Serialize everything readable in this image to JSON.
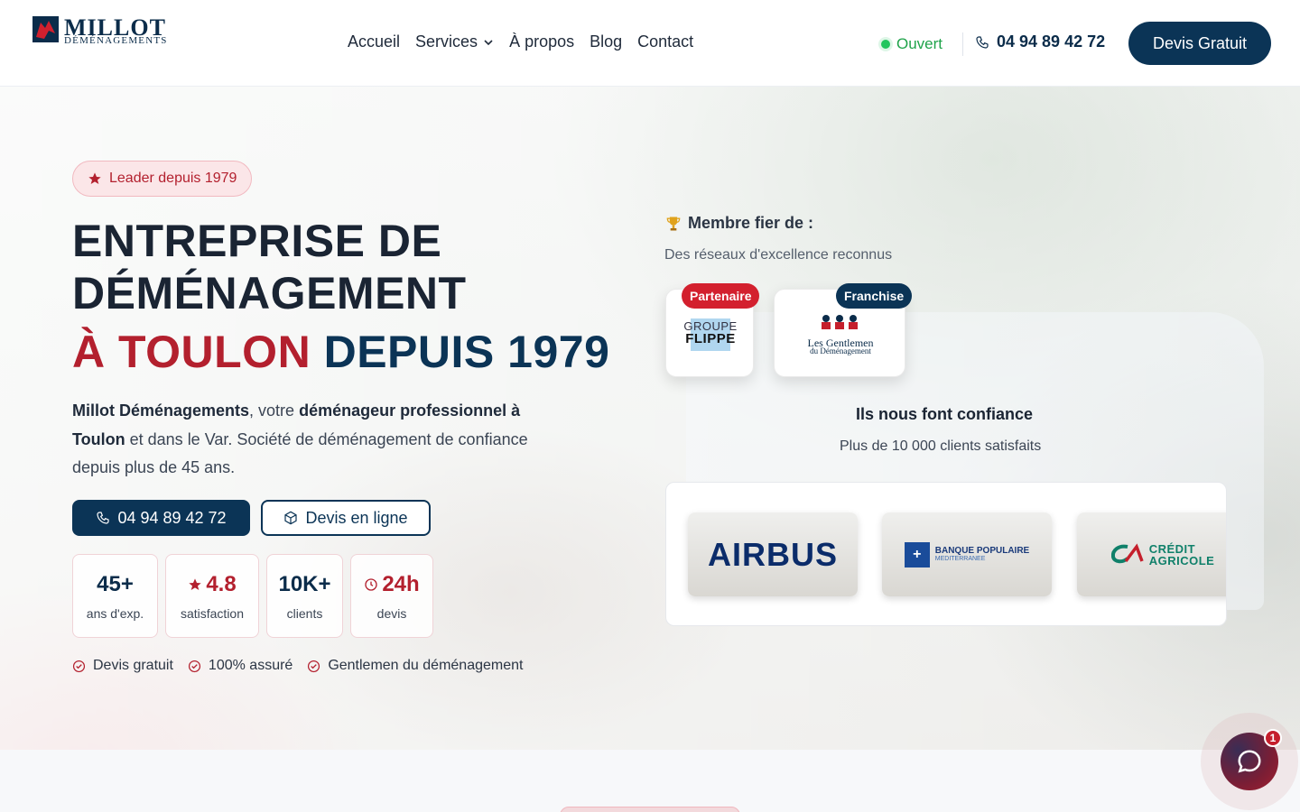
{
  "header": {
    "logo": {
      "title": "MILLOT",
      "subtitle": "DÉMÉNAGEMENTS"
    },
    "nav": [
      {
        "label": "Accueil"
      },
      {
        "label": "Services"
      },
      {
        "label": "À propos"
      },
      {
        "label": "Blog"
      },
      {
        "label": "Contact"
      }
    ],
    "status": "Ouvert",
    "phone": "04 94 89 42 72",
    "cta": "Devis Gratuit"
  },
  "hero": {
    "badge": "Leader depuis 1979",
    "title_line1": "ENTREPRISE DE",
    "title_line2": "DÉMÉNAGEMENT",
    "title_red": "À TOULON",
    "title_navy": "DEPUIS 1979",
    "lead": {
      "brand": "Millot Déménagements",
      "t1": ", votre ",
      "strong1": "déménageur professionnel à",
      "strong2": "Toulon",
      "t2": " et dans le Var. Société de déménagement de confiance",
      "t3": "depuis plus de 45 ans."
    },
    "phone_button": "04 94 89 42 72",
    "devis_button": "Devis en ligne",
    "stats": [
      {
        "value": "45+",
        "label": "ans d'exp."
      },
      {
        "value": "4.8",
        "label": "satisfaction"
      },
      {
        "value": "10K+",
        "label": "clients"
      },
      {
        "value": "24h",
        "label": "devis"
      }
    ],
    "checks": [
      "Devis gratuit",
      "100% assuré",
      "Gentlemen du déménagement"
    ]
  },
  "networks": {
    "title": "Membre fier de :",
    "subtitle": "Des réseaux d'excellence reconnus",
    "partners": [
      {
        "tag": "Partenaire",
        "logo_top": "GROUPE",
        "logo_bottom": "FLIPPE"
      },
      {
        "tag": "Franchise",
        "logo_top": "Les Gentlemen",
        "logo_bottom": "du Déménagement"
      }
    ]
  },
  "trust": {
    "title": "Ils nous font confiance",
    "subtitle": "Plus de 10 000 clients satisfaits",
    "clients": [
      {
        "name": "AIRBUS"
      },
      {
        "line1": "BANQUE POPULAIRE",
        "line2": "MEDITERRANEE"
      },
      {
        "line1": "CRÉDIT",
        "line2": "AGRICOLE"
      }
    ]
  },
  "chat": {
    "unread": "1"
  },
  "colors": {
    "navy": "#0b3456",
    "red": "#b3202e",
    "green": "#22c55e"
  }
}
